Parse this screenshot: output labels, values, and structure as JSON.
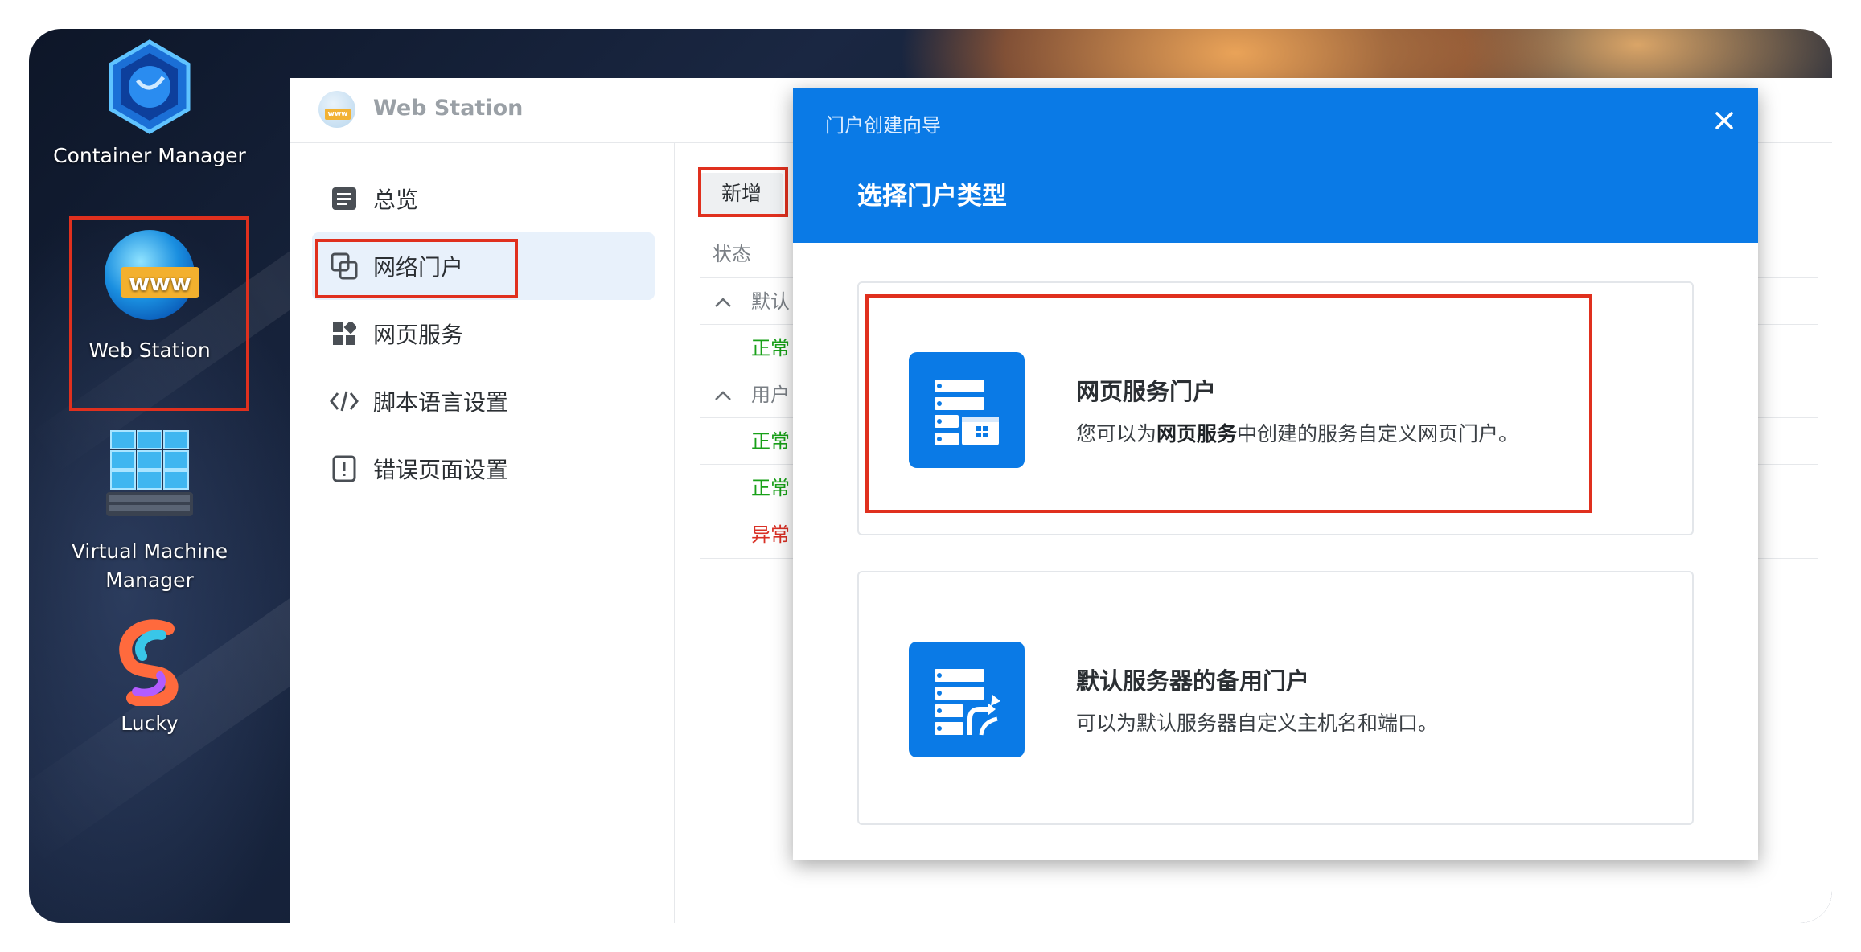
{
  "desktop": {
    "icons": [
      {
        "label": "Container Manager"
      },
      {
        "label": "Web Station"
      },
      {
        "label_line1": "Virtual Machine",
        "label_line2": "Manager"
      },
      {
        "label": "Lucky"
      }
    ]
  },
  "window": {
    "title": "Web Station",
    "logo_text": "www"
  },
  "sidebar": {
    "items": [
      {
        "label": "总览",
        "icon": "overview-icon"
      },
      {
        "label": "网络门户",
        "icon": "portal-icon",
        "active": true
      },
      {
        "label": "网页服务",
        "icon": "web-service-icon"
      },
      {
        "label": "脚本语言设置",
        "icon": "code-icon"
      },
      {
        "label": "错误页面设置",
        "icon": "error-page-icon"
      }
    ]
  },
  "content": {
    "add_button": "新增",
    "column_status": "状态",
    "groups": [
      {
        "label": "默认",
        "rows": [
          {
            "status": "正常"
          }
        ]
      },
      {
        "label": "用户",
        "rows": [
          {
            "status": "正常"
          },
          {
            "status": "正常"
          },
          {
            "status": "异常"
          }
        ]
      }
    ]
  },
  "dialog": {
    "title": "门户创建向导",
    "subtitle": "选择门户类型",
    "options": [
      {
        "title": "网页服务门户",
        "desc_prefix": "您可以为",
        "desc_bold": "网页服务",
        "desc_suffix": "中创建的服务自定义网页门户。"
      },
      {
        "title": "默认服务器的备用门户",
        "desc": "可以为默认服务器自定义主机名和端口。"
      }
    ]
  },
  "colors": {
    "accent": "#0a7ae6",
    "highlight": "#e0301e",
    "status_ok": "#18a018",
    "status_error": "#d93025"
  }
}
